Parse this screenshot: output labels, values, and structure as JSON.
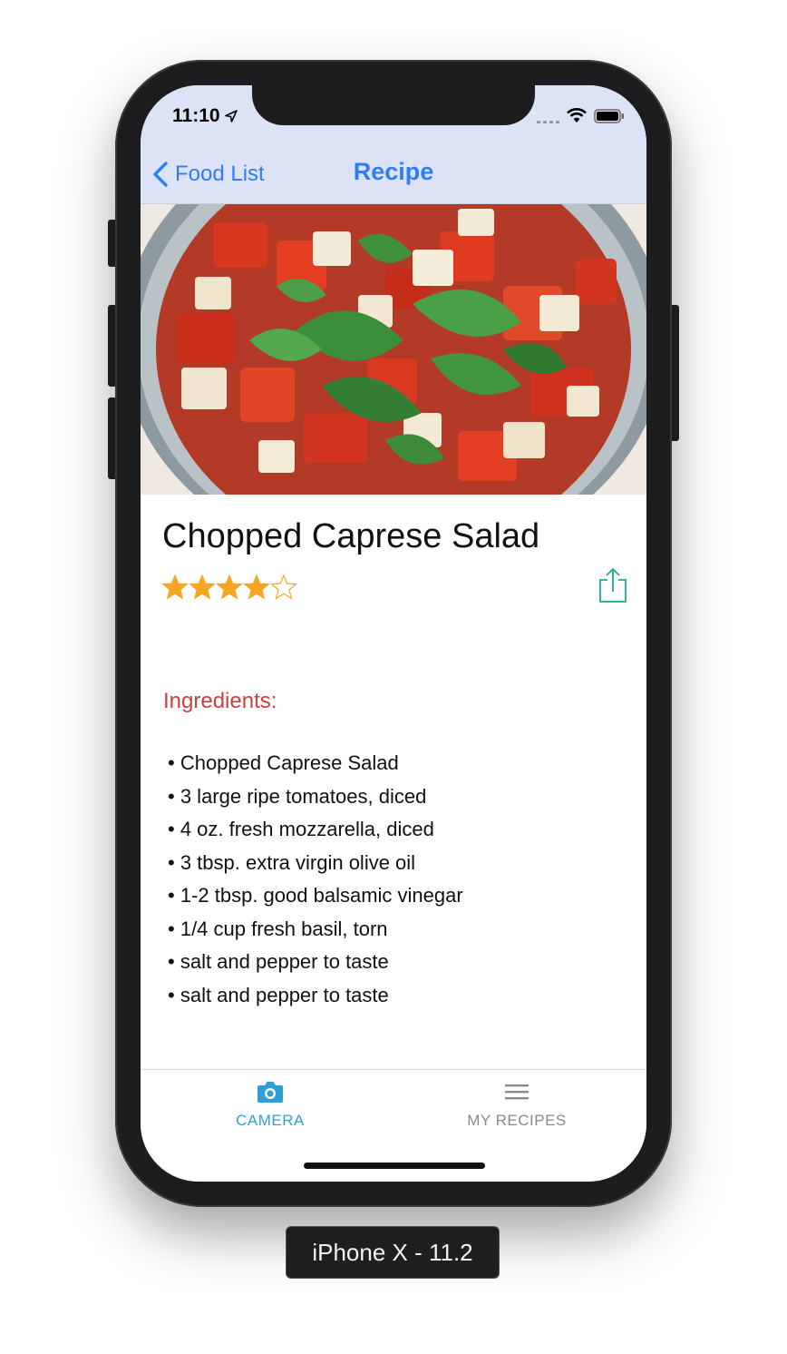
{
  "status_bar": {
    "time": "11:10"
  },
  "nav": {
    "back_label": "Food List",
    "title": "Recipe"
  },
  "recipe": {
    "title": "Chopped Caprese Salad",
    "rating": 4,
    "rating_max": 5,
    "ingredients_heading": "Ingredients:",
    "ingredients": [
      "Chopped Caprese Salad",
      "3 large ripe tomatoes, diced",
      "4 oz. fresh mozzarella, diced",
      "3 tbsp. extra virgin olive oil",
      "1-2 tbsp. good balsamic vinegar",
      "1/4 cup fresh basil, torn",
      "salt and pepper to taste",
      "salt and pepper to taste"
    ]
  },
  "tabs": [
    {
      "label": "CAMERA",
      "icon": "camera-icon",
      "selected": true
    },
    {
      "label": "MY RECIPES",
      "icon": "list-icon",
      "selected": false
    }
  ],
  "simulator_label": "iPhone X - 11.2",
  "colors": {
    "accent_blue": "#2f7df6",
    "nav_background": "#dce3f7",
    "ingredients_heading": "#c9403e",
    "star": "#f5a623",
    "share_icon": "#1aab9b",
    "tab_selected": "#2e9fd6",
    "tab_unselected": "#8a8a8a"
  }
}
